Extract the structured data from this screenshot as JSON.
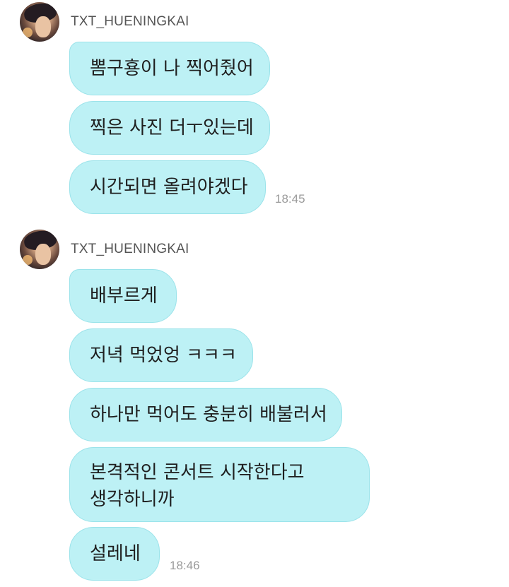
{
  "groups": [
    {
      "sender": "TXT_HUENINGKAI",
      "avatar_icon": "profile-photo",
      "messages": [
        "뽐구횽이 나 찍어줬어",
        "찍은 사진 더ㅜ있는데",
        "시간되면 올려야겠다"
      ],
      "time": "18:45"
    },
    {
      "sender": "TXT_HUENINGKAI",
      "avatar_icon": "profile-photo",
      "messages": [
        "배부르게",
        "저녁 먹었엉 ㅋㅋㅋ",
        "하나만 먹어도 충분히 배불러서",
        "본격적인 콘서트 시작한다고\n생각하니까",
        "설레네"
      ],
      "time": "18:46"
    }
  ],
  "colors": {
    "bubble": "#bdf1f5",
    "bubble_border": "#9be3ea",
    "text": "#1f1f1f",
    "sender": "#555555",
    "time": "#9a9a9a"
  }
}
